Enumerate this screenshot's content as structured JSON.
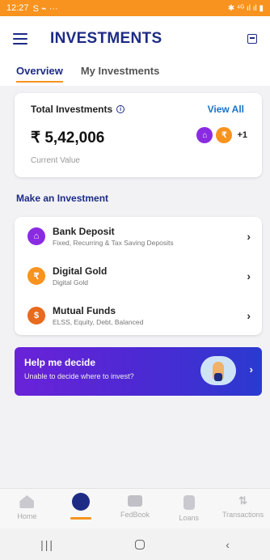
{
  "status_bar": {
    "time": "12:27",
    "left_icons": "S ⌁ ···",
    "right_icons": "✱ ⁴ᴳ ıl ıl ▮"
  },
  "header": {
    "title": "INVESTMENTS"
  },
  "tabs": [
    {
      "label": "Overview",
      "active": true
    },
    {
      "label": "My Investments",
      "active": false
    }
  ],
  "summary": {
    "title": "Total Investments",
    "view_all": "View All",
    "amount": "₹ 5,42,006",
    "subtitle": "Current Value",
    "more_count": "+1"
  },
  "make_investment": {
    "title": "Make an Investment",
    "items": [
      {
        "title": "Bank Deposit",
        "subtitle": "Fixed, Recurring & Tax Saving Deposits",
        "icon": "bank-deposit-icon",
        "color": "#8a2be2"
      },
      {
        "title": "Digital Gold",
        "subtitle": "Digital Gold",
        "icon": "gold-icon",
        "color": "#f7931e"
      },
      {
        "title": "Mutual Funds",
        "subtitle": "ELSS, Equity, Debt, Balanced",
        "icon": "mutual-funds-icon",
        "color": "#e86a1c"
      }
    ]
  },
  "help_banner": {
    "title": "Help me decide",
    "subtitle": "Unable to decide where to invest?"
  },
  "bottom_nav": [
    {
      "label": "Home",
      "icon": "home-icon",
      "active": false
    },
    {
      "label": "",
      "icon": "investments-icon",
      "active": true
    },
    {
      "label": "FedBook",
      "icon": "fedbook-icon",
      "active": false
    },
    {
      "label": "Loans",
      "icon": "loans-icon",
      "active": false
    },
    {
      "label": "Transactions",
      "icon": "transactions-icon",
      "active": false
    }
  ],
  "colors": {
    "primary": "#1d2b85",
    "accent": "#f7931e",
    "link": "#1a73c8"
  }
}
